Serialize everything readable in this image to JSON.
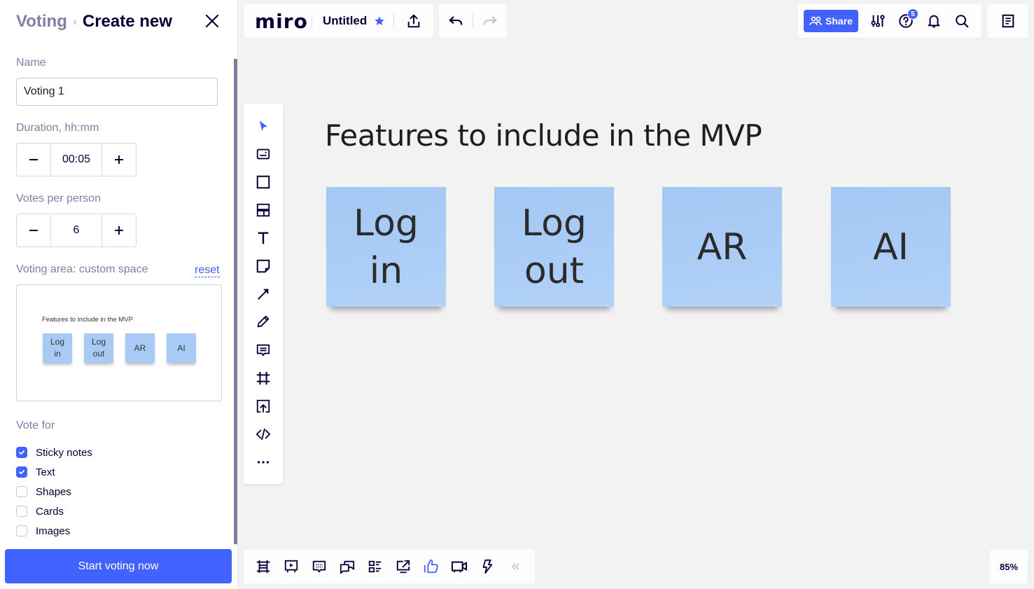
{
  "panel": {
    "breadcrumb_parent": "Voting",
    "breadcrumb_separator": "›",
    "title": "Create new",
    "name_label": "Name",
    "name_value": "Voting 1",
    "duration_label": "Duration, hh:mm",
    "duration_value": "00:05",
    "votes_label": "Votes per person",
    "votes_value": "6",
    "area_label": "Voting area: custom space",
    "reset_label": "reset",
    "preview": {
      "title": "Features to include in the MVP",
      "notes": [
        "Log\nin",
        "Log\nout",
        "AR",
        "AI"
      ]
    },
    "vote_for_label": "Vote for",
    "vote_for": [
      {
        "label": "Sticky notes",
        "checked": true
      },
      {
        "label": "Text",
        "checked": true
      },
      {
        "label": "Shapes",
        "checked": false
      },
      {
        "label": "Cards",
        "checked": false
      },
      {
        "label": "Images",
        "checked": false
      }
    ],
    "start_button": "Start voting now"
  },
  "topbar": {
    "logo": "miro",
    "board_title": "Untitled",
    "share_label": "Share",
    "help_badge": "5"
  },
  "canvas": {
    "title": "Features to include in the MVP",
    "notes": [
      "Log\nin",
      "Log\nout",
      "AR",
      "AI"
    ],
    "note_color": "#a8cbf5"
  },
  "zoom_level": "85%",
  "colors": {
    "accent": "#4262ff",
    "ink": "#050038",
    "muted": "#827fa2"
  }
}
